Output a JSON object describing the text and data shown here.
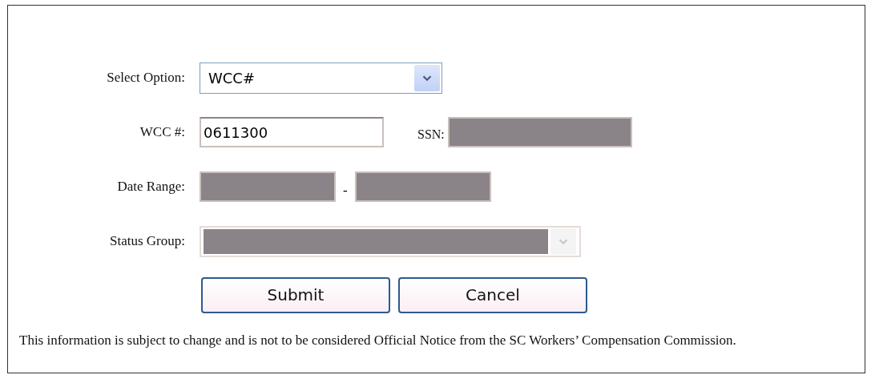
{
  "form": {
    "select_option": {
      "label": "Select Option:",
      "value": "WCC#",
      "disabled": false
    },
    "wcc": {
      "label": "WCC #:",
      "value": "0611300",
      "disabled": false
    },
    "ssn": {
      "label": "SSN:",
      "disabled": true
    },
    "date_range": {
      "label": "Date Range:",
      "separator": "-",
      "from_disabled": true,
      "to_disabled": true
    },
    "status_group": {
      "label": "Status Group:",
      "disabled": true
    },
    "buttons": [
      "Submit",
      "Cancel"
    ]
  },
  "notice": "This information is subject to change and is not to be considered Official Notice from the SC Workers’ Compensation Commission."
}
